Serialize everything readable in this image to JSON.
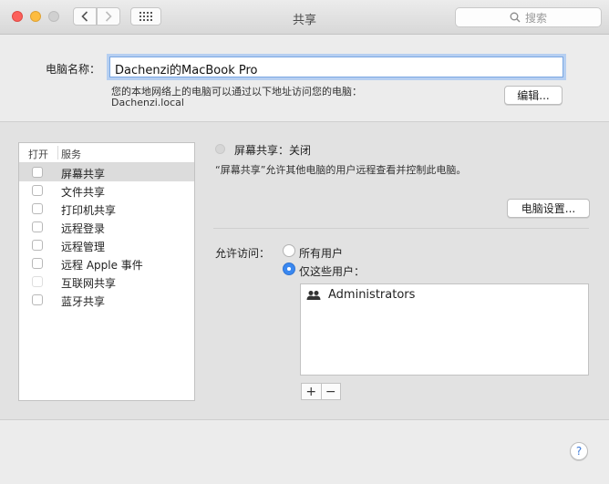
{
  "window": {
    "title": "共享",
    "search_placeholder": "搜索"
  },
  "computer_name": {
    "label": "电脑名称：",
    "value": "Dachenzi的MacBook Pro",
    "description": "您的本地网络上的电脑可以通过以下地址访问您的电脑：",
    "address": "Dachenzi.local",
    "edit_button": "编辑..."
  },
  "services": {
    "header_open": "打开",
    "header_service": "服务",
    "items": [
      {
        "label": "屏幕共享",
        "checked": false,
        "selected": true
      },
      {
        "label": "文件共享",
        "checked": false,
        "selected": false
      },
      {
        "label": "打印机共享",
        "checked": false,
        "selected": false
      },
      {
        "label": "远程登录",
        "checked": false,
        "selected": false
      },
      {
        "label": "远程管理",
        "checked": false,
        "selected": false
      },
      {
        "label": "远程 Apple 事件",
        "checked": false,
        "selected": false
      },
      {
        "label": "互联网共享",
        "checked": false,
        "selected": false,
        "disabled": true
      },
      {
        "label": "蓝牙共享",
        "checked": false,
        "selected": false
      }
    ]
  },
  "detail": {
    "status": "屏幕共享：关闭",
    "description": "“屏幕共享”允许其他电脑的用户远程查看并控制此电脑。",
    "computer_settings_button": "电脑设置...",
    "allow_access_label": "允许访问：",
    "options": [
      "所有用户",
      "仅这些用户："
    ],
    "selected_option": "仅这些用户：",
    "users": [
      "Administrators"
    ],
    "add_symbol": "+",
    "remove_symbol": "−"
  },
  "help_symbol": "?"
}
